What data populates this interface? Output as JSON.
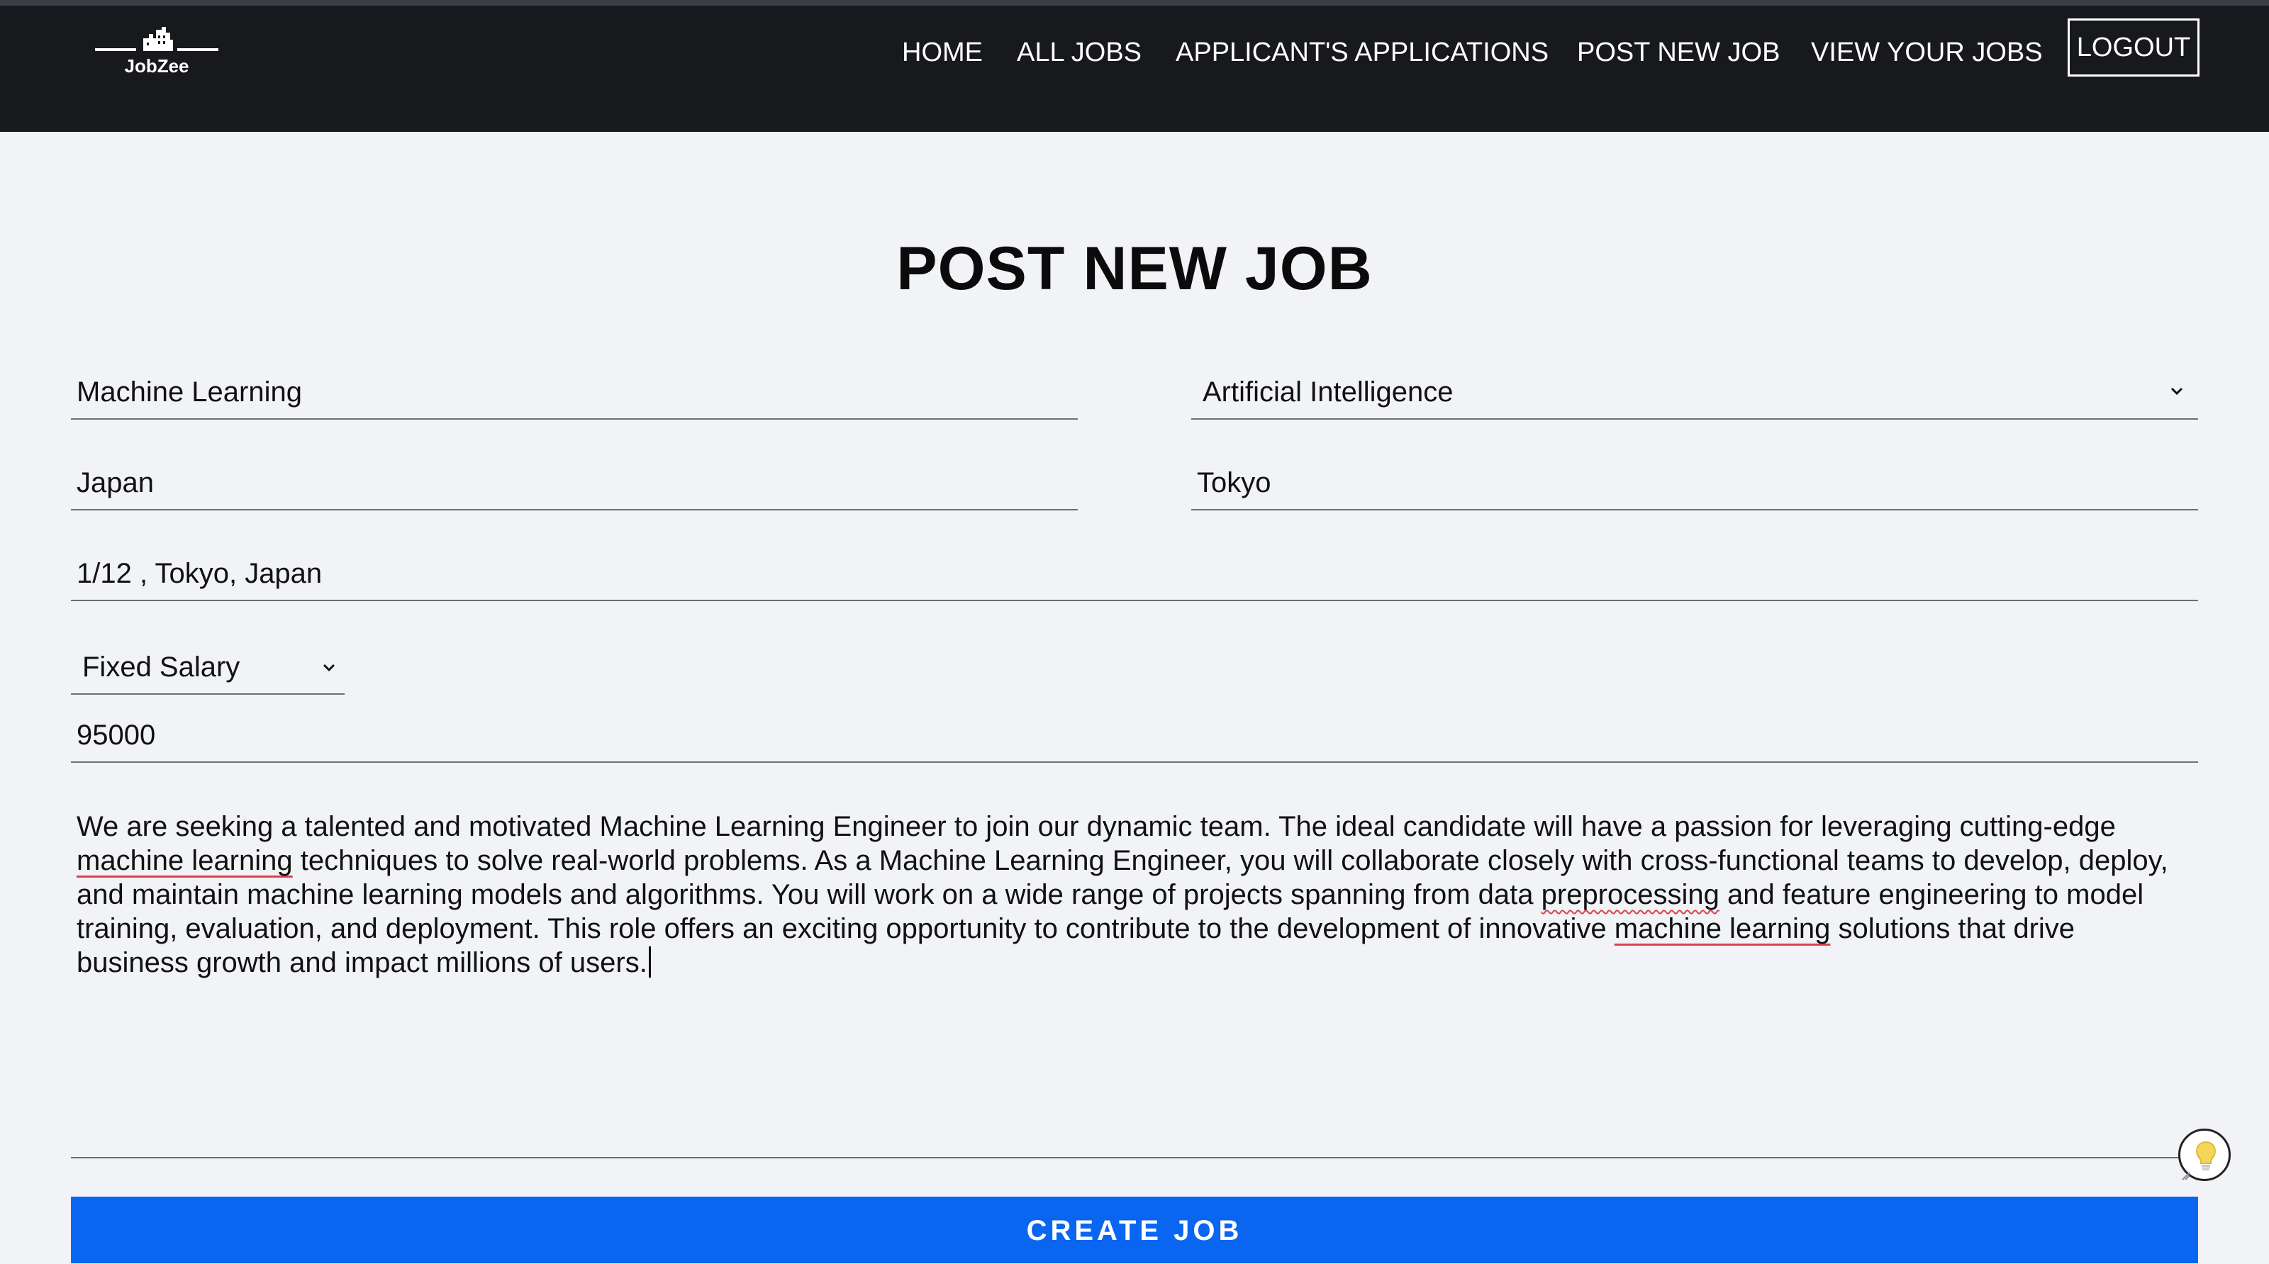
{
  "app": {
    "brand": "JobZee",
    "brand_icon": "building-logo-icon"
  },
  "nav": {
    "items": [
      {
        "label": "HOME"
      },
      {
        "label": "ALL JOBS"
      },
      {
        "label": "APPLICANT'S APPLICATIONS"
      },
      {
        "label": "POST NEW JOB"
      },
      {
        "label": "VIEW YOUR JOBS"
      }
    ],
    "logout_label": "LOGOUT"
  },
  "page": {
    "title": "POST NEW JOB"
  },
  "form": {
    "title_value": "Machine Learning",
    "category_value": "Artificial Intelligence",
    "country_value": "Japan",
    "city_value": "Tokyo",
    "location_value": "1/12 , Tokyo, Japan",
    "salary_type_value": "Fixed Salary",
    "salary_value": "95000",
    "description_lines": [
      "We are seeking a talented and motivated Machine Learning Engineer to join our dynamic team. The ideal candidate will have a passion for leveraging cutting-edge",
      "machine learning techniques to solve real-world problems. As a Machine Learning Engineer, you will collaborate closely with cross-functional teams to develop, deploy,",
      "and maintain machine learning models and algorithms. You will work on a wide range of projects spanning from data preprocessing and feature engineering to model",
      "training, evaluation, and deployment. This role offers an exciting opportunity to contribute to the development of innovative machine learning solutions that drive",
      "business growth and impact millions of users."
    ],
    "description_parts": {
      "l2_spell": "machine learning",
      "l2_rest": " techniques to solve real-world problems. As a Machine Learning Engineer, you will collaborate closely with cross-functional teams to develop, deploy,",
      "l3_pre": "and maintain machine learning models and algorithms. You will work on a wide range of projects spanning from data ",
      "l3_spell": "preprocessing",
      "l3_post": " and feature engineering to model",
      "l4_pre": "training, evaluation, and deployment. This role offers an exciting opportunity to contribute to the development of innovative ",
      "l4_spell": "machine learning",
      "l4_post": " solutions that drive"
    },
    "submit_label": "CREATE JOB"
  },
  "colors": {
    "navbar_bg": "#18191d",
    "page_bg": "#f1f3f6",
    "accent": "#0a66f0",
    "spellcheck": "#d9424e",
    "hint_bulb": "#f5d65a"
  },
  "icons": {
    "dropdown": "chevron-down-icon",
    "hint": "lightbulb-icon"
  }
}
